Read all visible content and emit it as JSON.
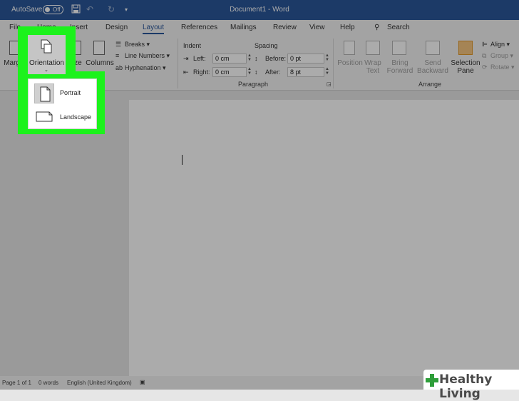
{
  "titlebar": {
    "autosave": "AutoSave",
    "toggle_state": "Off",
    "doc_title": "Document1 - Word"
  },
  "tabs": [
    "File",
    "Home",
    "Insert",
    "Design",
    "Layout",
    "References",
    "Mailings",
    "Review",
    "View",
    "Help"
  ],
  "search": "Search",
  "ribbon": {
    "margins": "Margins",
    "orientation": "Orientation",
    "size": "Size",
    "columns": "Columns",
    "breaks": "Breaks",
    "line_numbers": "Line Numbers",
    "hyphenation": "Hyphenation",
    "indent": {
      "title": "Indent",
      "left_label": "Left:",
      "left_value": "0 cm",
      "right_label": "Right:",
      "right_value": "0 cm"
    },
    "spacing": {
      "title": "Spacing",
      "before_label": "Before:",
      "before_value": "0 pt",
      "after_label": "After:",
      "after_value": "8 pt"
    },
    "paragraph_label": "Paragraph",
    "arrange": {
      "position": "Position",
      "wrap": "Wrap",
      "text": "Text",
      "bring": "Bring",
      "forward": "Forward",
      "send": "Send",
      "backward": "Backward",
      "selection": "Selection",
      "pane": "Pane",
      "align": "Align",
      "group": "Group",
      "rotate": "Rotate",
      "label": "Arrange"
    }
  },
  "orientation_menu": {
    "portrait": "Portrait",
    "landscape": "Landscape"
  },
  "status": {
    "page": "Page 1 of 1",
    "words": "0 words",
    "language": "English (United Kingdom)"
  },
  "watermark": "Healthy Living",
  "colors": {
    "accent": "#2b579a",
    "highlight": "#1cf21c"
  }
}
